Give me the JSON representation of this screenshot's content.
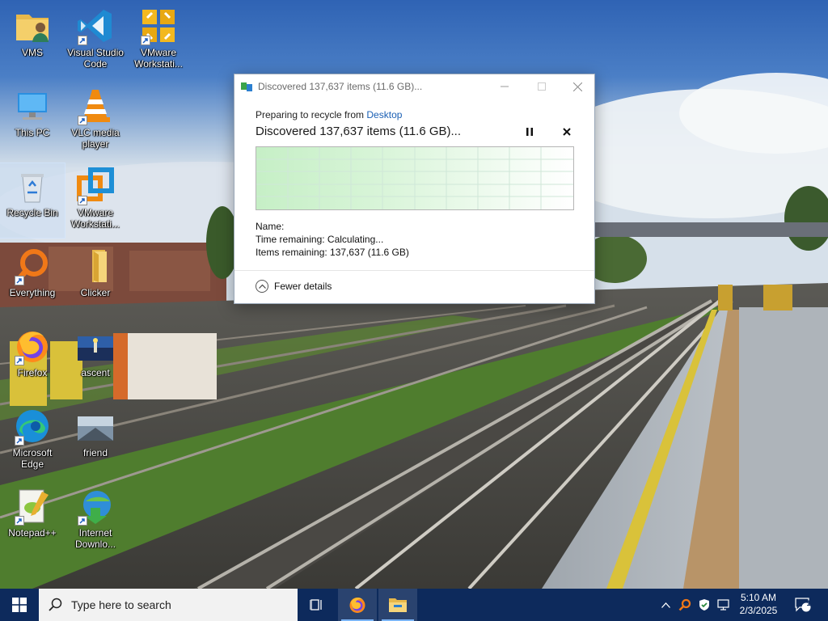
{
  "desktop": {
    "icons": [
      {
        "label": "VMS",
        "icon": "folder-user-icon"
      },
      {
        "label": "Visual Studio Code",
        "icon": "vscode-icon"
      },
      {
        "label": "VMware Workstati...",
        "icon": "vmware-icon"
      },
      {
        "label": "This PC",
        "icon": "computer-icon"
      },
      {
        "label": "VLC media player",
        "icon": "vlc-icon"
      },
      {
        "label": "Recycle Bin",
        "icon": "recycle-bin-icon"
      },
      {
        "label": "VMware Workstati...",
        "icon": "vmware-workstation-icon"
      },
      {
        "label": "Everything",
        "icon": "everything-search-icon"
      },
      {
        "label": "Clicker",
        "icon": "folder-icon"
      },
      {
        "label": "Firefox",
        "icon": "firefox-icon"
      },
      {
        "label": "ascent",
        "icon": "image-file-icon"
      },
      {
        "label": "Microsoft Edge",
        "icon": "edge-icon"
      },
      {
        "label": "friend",
        "icon": "image-file-icon"
      },
      {
        "label": "Notepad++",
        "icon": "notepadpp-icon"
      },
      {
        "label": "Internet Downlo...",
        "icon": "idm-icon"
      }
    ]
  },
  "dialog": {
    "title": "Discovered 137,637 items (11.6 GB)...",
    "subtitle_prefix": "Preparing to recycle from ",
    "subtitle_link": "Desktop",
    "heading": "Discovered 137,637 items (11.6 GB)...",
    "pause_symbol": "⏸",
    "stop_symbol": "✕",
    "name_label": "Name:",
    "time_remaining": "Time remaining:  Calculating...",
    "items_remaining": "Items remaining:  137,637 (11.6 GB)",
    "fewer_details": "Fewer details",
    "graph_fill_color": "#c6efc6"
  },
  "taskbar": {
    "search_placeholder": "Type here to search",
    "time": "5:10 AM",
    "date": "2/3/2025",
    "notification_count": "1",
    "background": "#0d2a5c"
  }
}
